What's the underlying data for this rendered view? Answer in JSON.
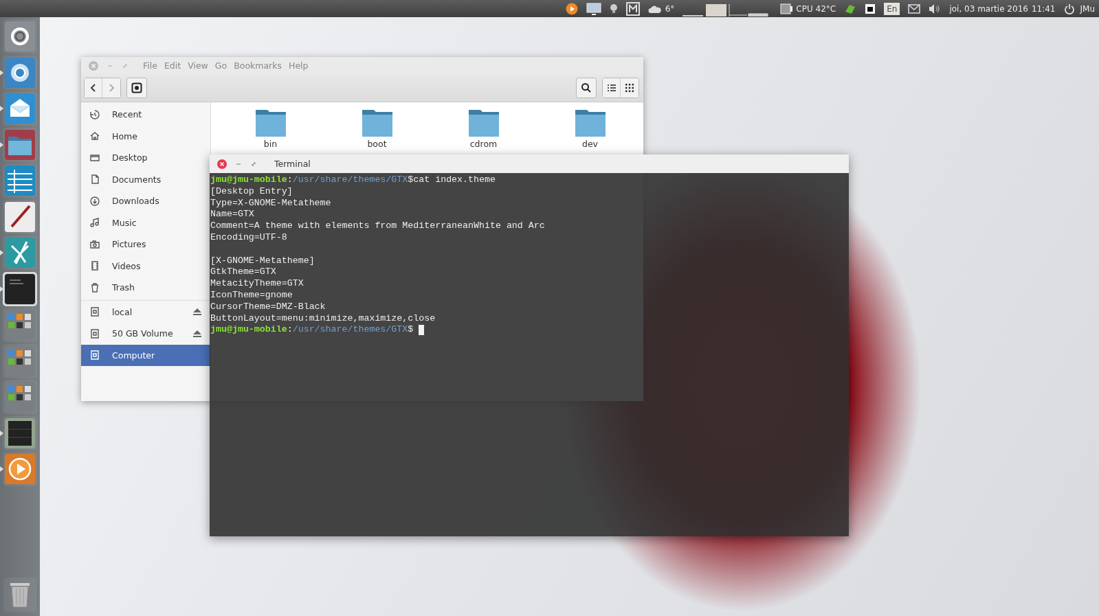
{
  "top_bar": {
    "weather": "6°",
    "cpu": "CPU 42°C",
    "keyboard": "En",
    "date": "joi, 03 martie 2016",
    "time": "11:41",
    "user": "JMu"
  },
  "launcher": {
    "items": [
      {
        "kind": "ubuntu",
        "running": false,
        "focused": false
      },
      {
        "kind": "browser",
        "running": true,
        "focused": false
      },
      {
        "kind": "mail",
        "running": true,
        "focused": false
      },
      {
        "kind": "files",
        "running": true,
        "focused": false
      },
      {
        "kind": "spreadsheet",
        "running": false,
        "focused": false
      },
      {
        "kind": "paint",
        "running": false,
        "focused": false
      },
      {
        "kind": "draw",
        "running": true,
        "focused": false
      },
      {
        "kind": "terminal",
        "running": true,
        "focused": true
      },
      {
        "kind": "group",
        "running": false,
        "focused": false
      },
      {
        "kind": "group",
        "running": false,
        "focused": false
      },
      {
        "kind": "group",
        "running": false,
        "focused": false
      },
      {
        "kind": "monitor",
        "running": true,
        "focused": false
      },
      {
        "kind": "player",
        "running": true,
        "focused": false
      }
    ]
  },
  "file_manager": {
    "menu": [
      "File",
      "Edit",
      "View",
      "Go",
      "Bookmarks",
      "Help"
    ],
    "sidebar": [
      {
        "kind": "recent",
        "label": "Recent",
        "selected": false
      },
      {
        "kind": "home",
        "label": "Home",
        "selected": false
      },
      {
        "kind": "desktop",
        "label": "Desktop",
        "selected": false
      },
      {
        "kind": "documents",
        "label": "Documents",
        "selected": false
      },
      {
        "kind": "downloads",
        "label": "Downloads",
        "selected": false
      },
      {
        "kind": "music",
        "label": "Music",
        "selected": false
      },
      {
        "kind": "pictures",
        "label": "Pictures",
        "selected": false
      },
      {
        "kind": "videos",
        "label": "Videos",
        "selected": false
      },
      {
        "kind": "trash",
        "label": "Trash",
        "selected": false
      },
      {
        "kind": "drive",
        "label": "local",
        "eject": true,
        "selected": false
      },
      {
        "kind": "drive",
        "label": "50 GB Volume",
        "eject": true,
        "selected": false
      },
      {
        "kind": "drive",
        "label": "Computer",
        "eject": false,
        "selected": true
      }
    ],
    "folders": [
      {
        "name": "bin"
      },
      {
        "name": "boot"
      },
      {
        "name": "cdrom"
      },
      {
        "name": "dev"
      }
    ]
  },
  "terminal": {
    "title": "Terminal",
    "lines": [
      {
        "kind": "prompt",
        "user": "jmu@jmu-mobile",
        "sep": ":",
        "path": "/usr/share/themes/GTX",
        "symbol": "$",
        "command": "cat index.theme",
        "cursor": false
      },
      {
        "kind": "output",
        "text": "[Desktop Entry]"
      },
      {
        "kind": "output",
        "text": "Type=X-GNOME-Metatheme"
      },
      {
        "kind": "output",
        "text": "Name=GTX"
      },
      {
        "kind": "output",
        "text": "Comment=A theme with elements from MediterraneanWhite and Arc"
      },
      {
        "kind": "output",
        "text": "Encoding=UTF-8"
      },
      {
        "kind": "blank"
      },
      {
        "kind": "output",
        "text": "[X-GNOME-Metatheme]"
      },
      {
        "kind": "output",
        "text": "GtkTheme=GTX"
      },
      {
        "kind": "output",
        "text": "MetacityTheme=GTX"
      },
      {
        "kind": "output",
        "text": "IconTheme=gnome"
      },
      {
        "kind": "output",
        "text": "CursorTheme=DMZ-Black"
      },
      {
        "kind": "output",
        "text": "ButtonLayout=menu:minimize,maximize,close"
      },
      {
        "kind": "prompt",
        "user": "jmu@jmu-mobile",
        "sep": ":",
        "path": "/usr/share/themes/GTX",
        "symbol": "$",
        "cursor": true
      }
    ]
  }
}
